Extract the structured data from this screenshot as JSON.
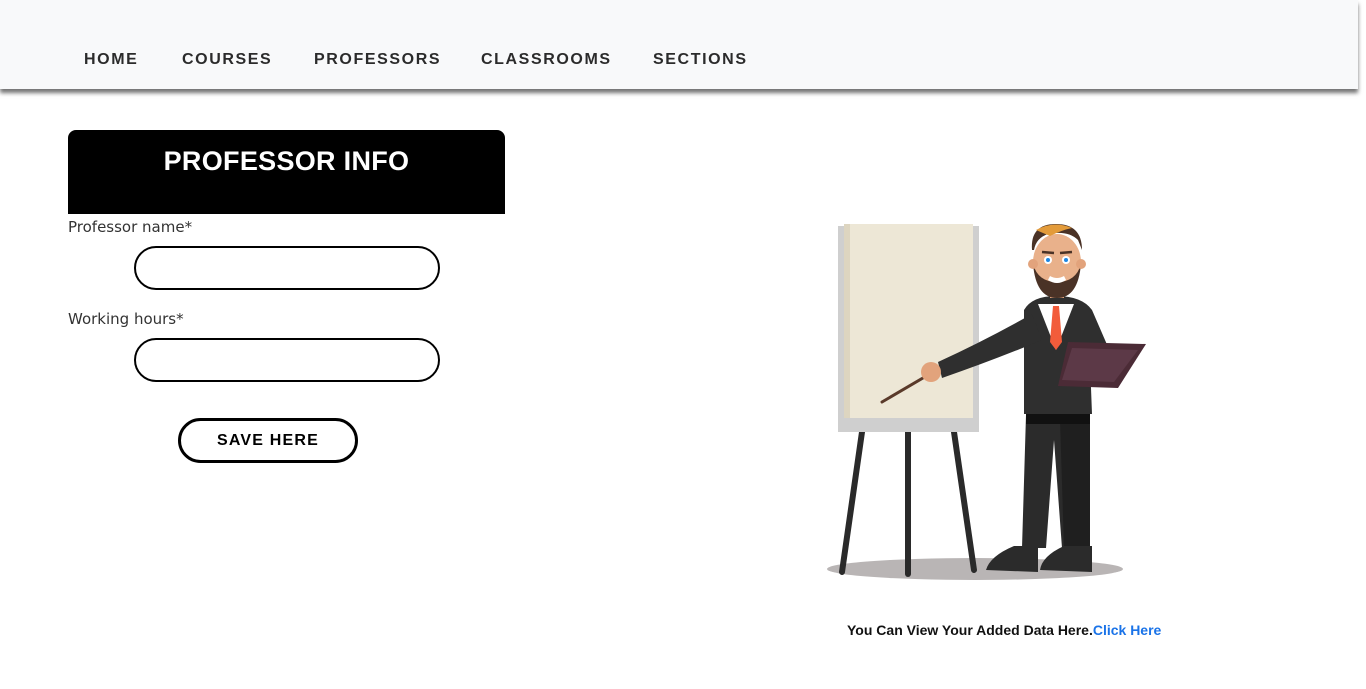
{
  "nav": {
    "items": [
      {
        "label": "HOME"
      },
      {
        "label": "COURSES"
      },
      {
        "label": "PROFESSORS"
      },
      {
        "label": "CLASSROOMS"
      },
      {
        "label": "SECTIONS"
      }
    ]
  },
  "form": {
    "title": "PROFESSOR INFO",
    "fields": [
      {
        "label": "Professor name*",
        "value": ""
      },
      {
        "label": "Working hours*",
        "value": ""
      }
    ],
    "save_label": "SAVE HERE"
  },
  "footer": {
    "text": "You Can View Your Added Data Here.",
    "link_text": "Click Here"
  },
  "colors": {
    "nav_background": "#f8f9fa",
    "header_background": "#000000",
    "link": "#1a73e8"
  },
  "illustration": {
    "icon": "professor-presenting-illustration"
  }
}
